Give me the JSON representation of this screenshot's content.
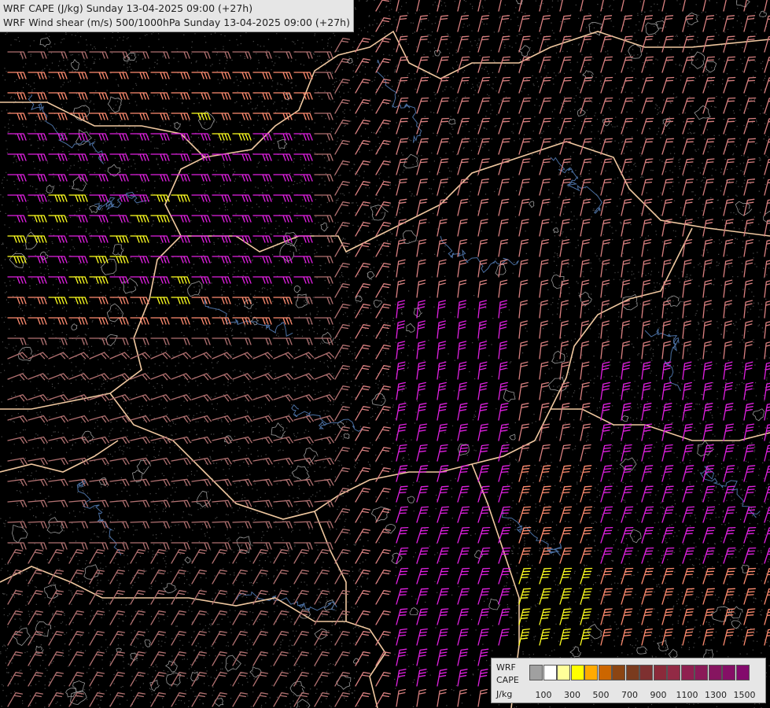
{
  "header": {
    "line1": "WRF CAPE (J/kg) Sunday 13-04-2025 09:00 (+27h)",
    "line2": "WRF Wind shear (m/s) 500/1000hPa Sunday 13-04-2025 09:00 (+27h)"
  },
  "legend": {
    "label_lines": [
      "WRF",
      "CAPE",
      "J/kg"
    ],
    "colors": [
      "#a0a0a0",
      "#ffffff",
      "#ffff99",
      "#ffff00",
      "#ffaa00",
      "#cc6600",
      "#8b4513",
      "#7a3b1e",
      "#7e3030",
      "#8b2a3a",
      "#922a45",
      "#8f2050",
      "#8a1a58",
      "#861560",
      "#850f66",
      "#830a6c"
    ],
    "tick_labels": [
      "100",
      "300",
      "500",
      "700",
      "900",
      "1100",
      "1300",
      "1500"
    ]
  },
  "map": {
    "barb_colors": {
      "low": "#d98080",
      "medium": "#ff8c70",
      "high": "#e020e0",
      "very_high": "#ffff20",
      "faint": "#b07070"
    },
    "border_color": "#f0c8a0",
    "river_color": "#4a6ea0",
    "contour_color": "#9a9a9a"
  }
}
